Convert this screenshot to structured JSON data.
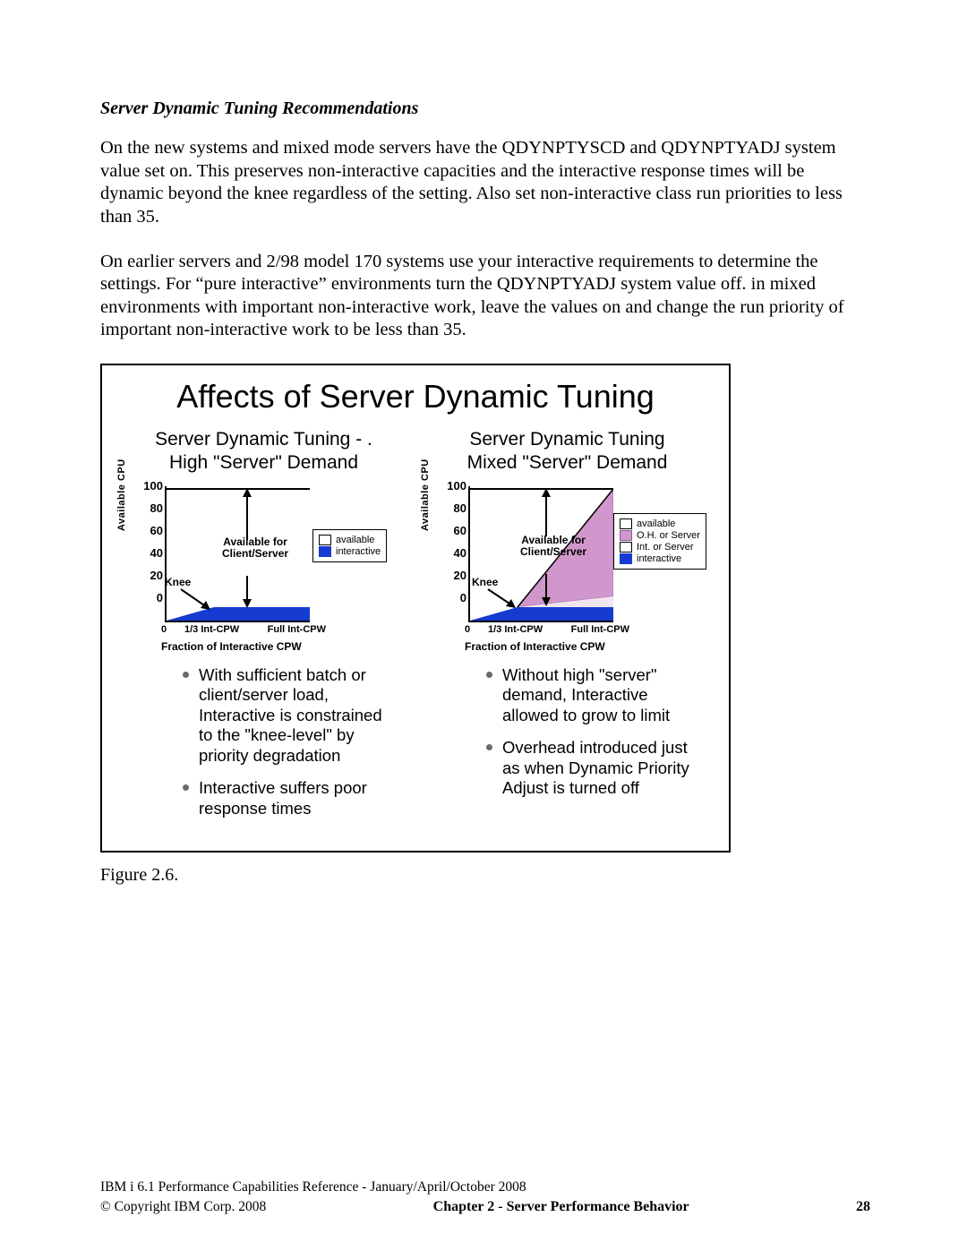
{
  "heading": "Server Dynamic Tuning Recommendations",
  "para1": "On the new systems and mixed mode servers have the QDYNPTYSCD and  QDYNPTYADJ system value set on.  This preserves non-interactive capacities and the interactive response times will be dynamic beyond the knee regardless of the setting. Also set non-interactive class run priorities to less than 35.",
  "para2": "On earlier servers and 2/98 model 170 systems use your interactive requirements to determine the settings.  For “pure interactive” environments turn the QDYNPTYADJ system value off.  in mixed environments with important non-interactive work, leave the values on and change the run priority of important non-interactive work to be less than 35.",
  "figure_title": "Affects of Server Dynamic Tuning",
  "caption": "Figure 2.6.",
  "left": {
    "title": "Server Dynamic Tuning - .\nHigh \"Server\" Demand",
    "annot_avail": "Available for\nClient/Server",
    "annot_knee": "Knee",
    "bullets": [
      "With sufficient batch or client/server load, Interactive is constrained to the \"knee-level\" by priority degradation",
      "Interactive suffers poor response times"
    ],
    "legend": [
      "available",
      "interactive"
    ]
  },
  "right": {
    "title": "Server Dynamic Tuning\nMixed \"Server\" Demand",
    "annot_avail": "Available for\nClient/Server",
    "annot_knee": "Knee",
    "bullets": [
      "Without high \"server\" demand, Interactive allowed to grow to limit",
      "Overhead introduced just as when Dynamic Priority Adjust is turned off"
    ],
    "legend": [
      "available",
      "O.H. or Server",
      "Int. or Server",
      "interactive"
    ]
  },
  "axes": {
    "ylabel": "Available CPU",
    "yticks": [
      "100",
      "80",
      "60",
      "40",
      "20",
      "0"
    ],
    "xticks": [
      "0",
      "1/3 Int-CPW",
      "Full Int-CPW"
    ],
    "xlabel": "Fraction of Interactive CPW"
  },
  "footer": {
    "line1": "IBM i 6.1 Performance Capabilities Reference - January/April/October 2008",
    "copyright": "© Copyright IBM Corp. 2008",
    "chapter": "Chapter 2 - Server Performance Behavior",
    "pageno": "28"
  },
  "chart_data": [
    {
      "type": "area",
      "title": "Server Dynamic Tuning - High \"Server\" Demand",
      "xlabel": "Fraction of Interactive CPW",
      "ylabel": "Available CPU",
      "ylim": [
        0,
        100
      ],
      "x_categories": [
        "0",
        "1/3 Int-CPW",
        "Full Int-CPW"
      ],
      "series": [
        {
          "name": "available (Client/Server capacity)",
          "x": [
            0,
            0.333,
            1
          ],
          "y_top": [
            100,
            100,
            100
          ],
          "y_bottom_of_region": [
            0,
            10,
            10
          ]
        },
        {
          "name": "interactive",
          "x": [
            0,
            0.333,
            1
          ],
          "y": [
            0,
            10,
            10
          ]
        }
      ],
      "annotations": [
        {
          "text": "Knee",
          "x": 0.18,
          "y": 12
        },
        {
          "text": "Available for Client/Server",
          "x": 0.65,
          "y": 55
        }
      ]
    },
    {
      "type": "area",
      "title": "Server Dynamic Tuning - Mixed \"Server\" Demand",
      "xlabel": "Fraction of Interactive CPW",
      "ylabel": "Available CPU",
      "ylim": [
        0,
        100
      ],
      "x_categories": [
        "0",
        "1/3 Int-CPW",
        "Full Int-CPW"
      ],
      "series": [
        {
          "name": "available",
          "x": [
            0,
            0.333,
            1
          ],
          "y_top": [
            100,
            100,
            100
          ]
        },
        {
          "name": "O.H. or Server",
          "x": [
            0,
            0.333,
            1
          ],
          "y_top": [
            0,
            10,
            100
          ],
          "y_bottom": [
            0,
            10,
            18
          ]
        },
        {
          "name": "Int. or Server",
          "x": [
            0,
            0.333,
            1
          ],
          "y_top": [
            0,
            10,
            18
          ],
          "y_bottom": [
            0,
            10,
            10
          ]
        },
        {
          "name": "interactive",
          "x": [
            0,
            0.333,
            1
          ],
          "y": [
            0,
            10,
            10
          ]
        }
      ],
      "annotations": [
        {
          "text": "Knee",
          "x": 0.2,
          "y": 14
        },
        {
          "text": "Available for Client/Server",
          "x": 0.62,
          "y": 52
        }
      ]
    }
  ]
}
